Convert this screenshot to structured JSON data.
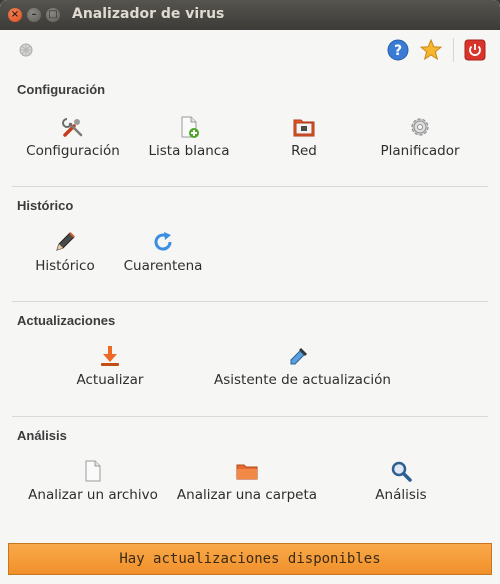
{
  "window": {
    "title": "Analizador de virus"
  },
  "toolbar": {
    "app_icon": "virus-scanner-icon",
    "help_icon": "help-icon",
    "favorite_icon": "star-icon",
    "power_icon": "power-icon"
  },
  "sections": {
    "config": {
      "title": "Configuración",
      "items": [
        "Configuración",
        "Lista blanca",
        "Red",
        "Planificador"
      ]
    },
    "history": {
      "title": "Histórico",
      "items": [
        "Histórico",
        "Cuarentena"
      ]
    },
    "updates": {
      "title": "Actualizaciones",
      "items": [
        "Actualizar",
        "Asistente de actualización"
      ]
    },
    "analysis": {
      "title": "Análisis",
      "items": [
        "Analizar un archivo",
        "Analizar una carpeta",
        "Análisis"
      ]
    }
  },
  "statusbar": {
    "text": "Hay actualizaciones disponibles"
  },
  "colors": {
    "accent": "#f0902a",
    "close": "#df4a16"
  }
}
